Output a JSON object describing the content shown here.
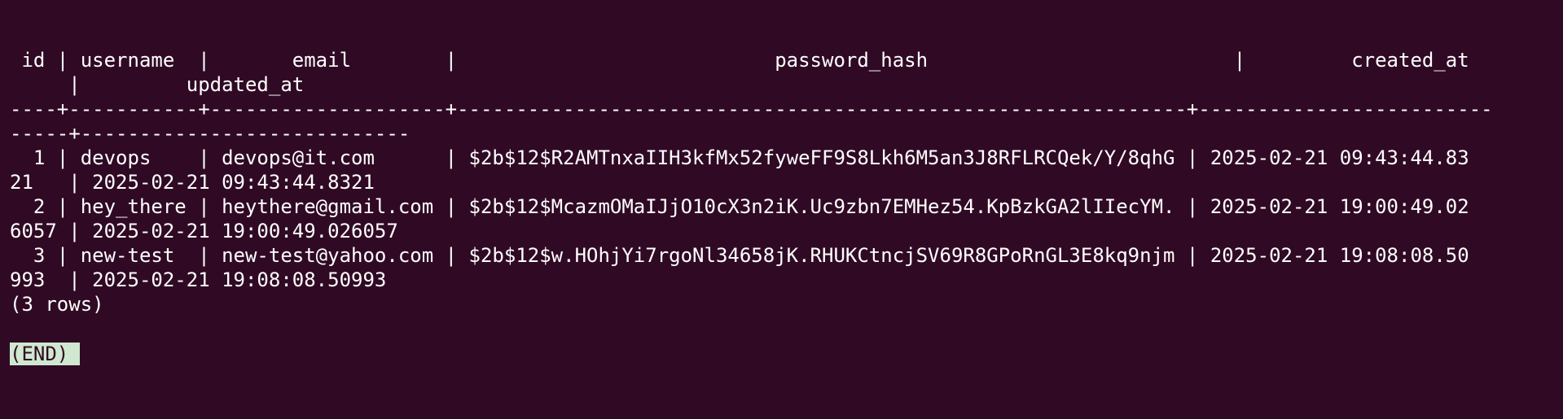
{
  "terminal": {
    "theme": {
      "background": "#300a24",
      "foreground": "#ffffff",
      "pager_highlight": "#cfe8cf"
    },
    "lines": [
      " id | username  |       email        |                           password_hash                          |         created_at",
      "     |         updated_at",
      "----+-----------+--------------------+--------------------------------------------------------------+-------------------------",
      "-----+----------------------------",
      "  1 | devops    | devops@it.com      | $2b$12$R2AMTnxaIIH3kfMx52fyweFF9S8Lkh6M5an3J8RFLRCQek/Y/8qhG | 2025-02-21 09:43:44.83",
      "21   | 2025-02-21 09:43:44.8321",
      "  2 | hey_there | heythere@gmail.com | $2b$12$McazmOMaIJjO10cX3n2iK.Uc9zbn7EMHez54.KpBzkGA2lIIecYM. | 2025-02-21 19:00:49.02",
      "6057 | 2025-02-21 19:00:49.026057",
      "  3 | new-test  | new-test@yahoo.com | $2b$12$w.HOhjYi7rgoNl34658jK.RHUKCtncjSV69R8GPoRnGL3E8kq9njm | 2025-02-21 19:08:08.50",
      "993  | 2025-02-21 19:08:08.50993",
      "(3 rows)"
    ],
    "pager_prompt": "(END)"
  }
}
